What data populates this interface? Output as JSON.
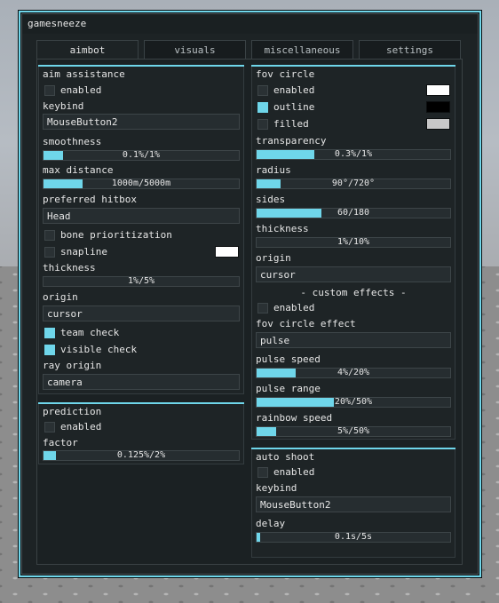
{
  "window": {
    "title": "gamesneeze"
  },
  "tabs": [
    "aimbot",
    "visuals",
    "miscellaneous",
    "settings"
  ],
  "colors": {
    "accent": "#6fd6ea",
    "white": "#ffffff",
    "black": "#000000",
    "gray": "#c8c8c8"
  },
  "aim_assistance": {
    "title": "aim assistance",
    "enabled_label": "enabled",
    "keybind_label": "keybind",
    "keybind_value": "MouseButton2",
    "smoothness_label": "smoothness",
    "smoothness_value": "0.1%/1%",
    "smoothness_fraction": 0.1,
    "max_distance_label": "max distance",
    "max_distance_value": "1000m/5000m",
    "max_distance_fraction": 0.2,
    "preferred_hitbox_label": "preferred hitbox",
    "preferred_hitbox_value": "Head",
    "bone_prioritization_label": "bone prioritization",
    "snapline_label": "snapline",
    "thickness_label": "thickness",
    "thickness_value": "1%/5%",
    "origin_label": "origin",
    "origin_value": "cursor",
    "team_check_label": "team check",
    "visible_check_label": "visible check",
    "ray_origin_label": "ray origin",
    "ray_origin_value": "camera"
  },
  "prediction": {
    "title": "prediction",
    "enabled_label": "enabled",
    "factor_label": "factor",
    "factor_value": "0.125%/2%",
    "factor_fraction": 0.0625
  },
  "fov_circle": {
    "title": "fov circle",
    "enabled_label": "enabled",
    "outline_label": "outline",
    "filled_label": "filled",
    "transparency_label": "transparency",
    "transparency_value": "0.3%/1%",
    "transparency_fraction": 0.3,
    "radius_label": "radius",
    "radius_value": "90°/720°",
    "radius_fraction": 0.125,
    "sides_label": "sides",
    "sides_value": "60/180",
    "sides_fraction": 0.333,
    "thickness_label": "thickness",
    "thickness_value": "1%/10%",
    "origin_label": "origin",
    "origin_value": "cursor",
    "custom_effects_label": "- custom effects -",
    "effects_enabled_label": "enabled",
    "fov_effect_label": "fov circle effect",
    "fov_effect_value": "pulse",
    "pulse_speed_label": "pulse speed",
    "pulse_speed_value": "4%/20%",
    "pulse_speed_fraction": 0.2,
    "pulse_range_label": "pulse range",
    "pulse_range_value": "20%/50%",
    "pulse_range_fraction": 0.4,
    "rainbow_speed_label": "rainbow speed",
    "rainbow_speed_value": "5%/50%",
    "rainbow_speed_fraction": 0.1
  },
  "auto_shoot": {
    "title": "auto shoot",
    "enabled_label": "enabled",
    "keybind_label": "keybind",
    "keybind_value": "MouseButton2",
    "delay_label": "delay",
    "delay_value": "0.1s/5s",
    "delay_fraction": 0.02
  }
}
